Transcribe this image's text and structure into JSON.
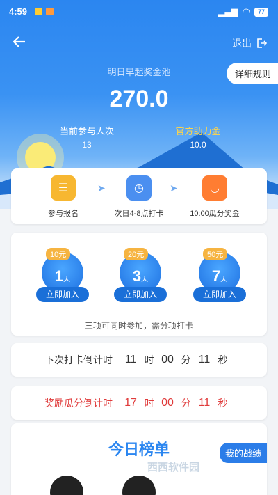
{
  "status": {
    "time": "4:59",
    "battery": "77"
  },
  "header": {
    "back_icon": "arrow-left-icon",
    "exit_label": "退出"
  },
  "pool": {
    "title": "明日早起奖金池",
    "amount": "270.0",
    "rules_label": "详细规则"
  },
  "stats": {
    "participants_label": "当前参与人次",
    "participants_value": "13",
    "official_label": "官方助力金",
    "official_value": "10.0"
  },
  "steps": [
    {
      "label": "参与报名",
      "icon": "signup-icon"
    },
    {
      "label": "次日4-8点打卡",
      "icon": "clock-icon"
    },
    {
      "label": "10:00瓜分奖金",
      "icon": "wallet-icon"
    }
  ],
  "plans": [
    {
      "price": "10元",
      "days": "1",
      "unit": "天",
      "join": "立即加入"
    },
    {
      "price": "20元",
      "days": "3",
      "unit": "天",
      "join": "立即加入"
    },
    {
      "price": "50元",
      "days": "7",
      "unit": "天",
      "join": "立即加入"
    }
  ],
  "plans_note": "三项可同时参加，需分项打卡",
  "countdown_checkin": {
    "label": "下次打卡倒计时",
    "h": "11",
    "hu": "时",
    "m": "00",
    "mu": "分",
    "s": "11",
    "su": "秒"
  },
  "countdown_reward": {
    "label": "奖励瓜分倒计时",
    "h": "17",
    "hu": "时",
    "m": "00",
    "mu": "分",
    "s": "11",
    "su": "秒"
  },
  "rank": {
    "title": "今日榜单",
    "my_label": "我的战绩"
  },
  "watermark": "西西软件园"
}
